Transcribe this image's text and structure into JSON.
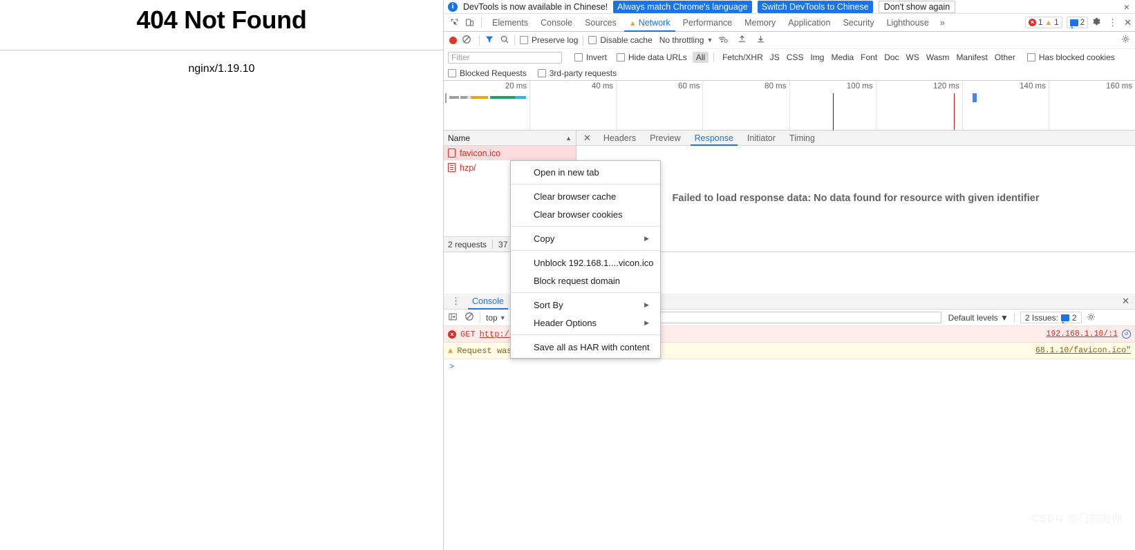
{
  "page": {
    "title": "404 Not Found",
    "server": "nginx/1.19.10"
  },
  "notice": {
    "icon": "info-icon",
    "message": "DevTools is now available in Chinese!",
    "always_match_label": "Always match Chrome's language",
    "switch_label": "Switch DevTools to Chinese",
    "dont_show_label": "Don't show again",
    "close": "×"
  },
  "tabstrip": {
    "inspect_icon": "inspect-element-icon",
    "device_icon": "device-toolbar-icon",
    "tabs": [
      {
        "label": "Elements",
        "active": false,
        "warn": false
      },
      {
        "label": "Console",
        "active": false,
        "warn": false
      },
      {
        "label": "Sources",
        "active": false,
        "warn": false
      },
      {
        "label": "Network",
        "active": true,
        "warn": true
      },
      {
        "label": "Performance",
        "active": false,
        "warn": false
      },
      {
        "label": "Memory",
        "active": false,
        "warn": false
      },
      {
        "label": "Application",
        "active": false,
        "warn": false
      },
      {
        "label": "Security",
        "active": false,
        "warn": false
      },
      {
        "label": "Lighthouse",
        "active": false,
        "warn": false
      }
    ],
    "more": "»",
    "error_count": "1",
    "warning_count": "1",
    "message_count": "2",
    "settings_icon": "gear-icon",
    "kebab_icon": "more-options-icon",
    "close_icon": "close-icon"
  },
  "netbar": {
    "record_title": "record-button",
    "clear_title": "clear-button",
    "filter_icon": "funnel-icon",
    "search_icon": "search-icon",
    "preserve_log": "Preserve log",
    "disable_cache": "Disable cache",
    "throttling": "No throttling",
    "caret": "▼",
    "wifi_icon": "network-conditions-icon",
    "import_icon": "import-har-icon",
    "export_icon": "export-har-icon",
    "settings_icon": "gear-icon"
  },
  "filterbar": {
    "placeholder": "Filter",
    "value": "",
    "invert": "Invert",
    "hide_data_urls": "Hide data URLs",
    "types": [
      "All",
      "Fetch/XHR",
      "JS",
      "CSS",
      "Img",
      "Media",
      "Font",
      "Doc",
      "WS",
      "Wasm",
      "Manifest",
      "Other"
    ],
    "selected_type": "All",
    "has_blocked_cookies": "Has blocked cookies"
  },
  "blockbar": {
    "blocked_requests": "Blocked Requests",
    "third_party": "3rd-party requests"
  },
  "overview": {
    "ticks": [
      "20 ms",
      "40 ms",
      "60 ms",
      "80 ms",
      "100 ms",
      "120 ms",
      "140 ms",
      "160 ms"
    ],
    "bar_segments": [
      {
        "color": "#9e9e9e",
        "width": 14
      },
      {
        "color": "#ffffff",
        "width": 2
      },
      {
        "color": "#9e9e9e",
        "width": 10
      },
      {
        "color": "#e0e0e0",
        "width": 5
      },
      {
        "color": "#f0a30a",
        "width": 25
      },
      {
        "color": "#ffffff",
        "width": 3
      },
      {
        "color": "#1aa260",
        "width": 36
      },
      {
        "color": "#29b6f6",
        "width": 16
      }
    ],
    "dom_content_loaded_color": "#1a237e",
    "load_event_color": "#b71c1c",
    "marker_color": "#4285f4"
  },
  "requests": {
    "name_header": "Name",
    "sort_arrow": "▲",
    "rows": [
      {
        "name": "favicon.ico",
        "icon": "image-file-icon",
        "selected": true
      },
      {
        "name": "hzp/",
        "icon": "document-file-icon",
        "selected": false
      }
    ],
    "status_requests": "2 requests",
    "status_transferred": "37"
  },
  "detail": {
    "close_icon": "close-icon",
    "tabs": [
      {
        "label": "Headers",
        "active": false
      },
      {
        "label": "Preview",
        "active": false
      },
      {
        "label": "Response",
        "active": true
      },
      {
        "label": "Initiator",
        "active": false
      },
      {
        "label": "Timing",
        "active": false
      }
    ],
    "message": "Failed to load response data: No data found for resource with given identifier"
  },
  "context_menu": {
    "items": [
      {
        "label": "Open in new tab",
        "submenu": false,
        "separator_after": true
      },
      {
        "label": "Clear browser cache",
        "submenu": false,
        "separator_after": false
      },
      {
        "label": "Clear browser cookies",
        "submenu": false,
        "separator_after": true
      },
      {
        "label": "Copy",
        "submenu": true,
        "separator_after": true
      },
      {
        "label": "Unblock 192.168.1....vicon.ico",
        "submenu": false,
        "separator_after": false
      },
      {
        "label": "Block request domain",
        "submenu": false,
        "separator_after": true
      },
      {
        "label": "Sort By",
        "submenu": true,
        "separator_after": false
      },
      {
        "label": "Header Options",
        "submenu": true,
        "separator_after": true
      },
      {
        "label": "Save all as HAR with content",
        "submenu": false,
        "separator_after": false
      }
    ],
    "submenu_arrow": "▶"
  },
  "drawer": {
    "kebab_icon": "more-tools-icon",
    "tab_label": "Console",
    "close_icon": "close-icon",
    "sidebar_icon": "console-sidebar-icon",
    "clear_icon": "clear-console-icon",
    "context": "top",
    "context_caret": "▼",
    "filter_placeholder": "Filter",
    "filter_value": "",
    "levels_label": "Default levels",
    "levels_caret": "▼",
    "issues_label": "2 Issues:",
    "issues_count": "2",
    "settings_icon": "gear-icon",
    "messages": [
      {
        "type": "error",
        "method": "GET",
        "url": "http://",
        "source": "192.168.1.10/:1",
        "trailing_icon": "network-request-icon"
      },
      {
        "type": "warning",
        "text": "Request was",
        "suffix": "68.1.10/favicon.ico\""
      }
    ],
    "prompt": ">"
  },
  "watermark": "CSDN @门前的你"
}
